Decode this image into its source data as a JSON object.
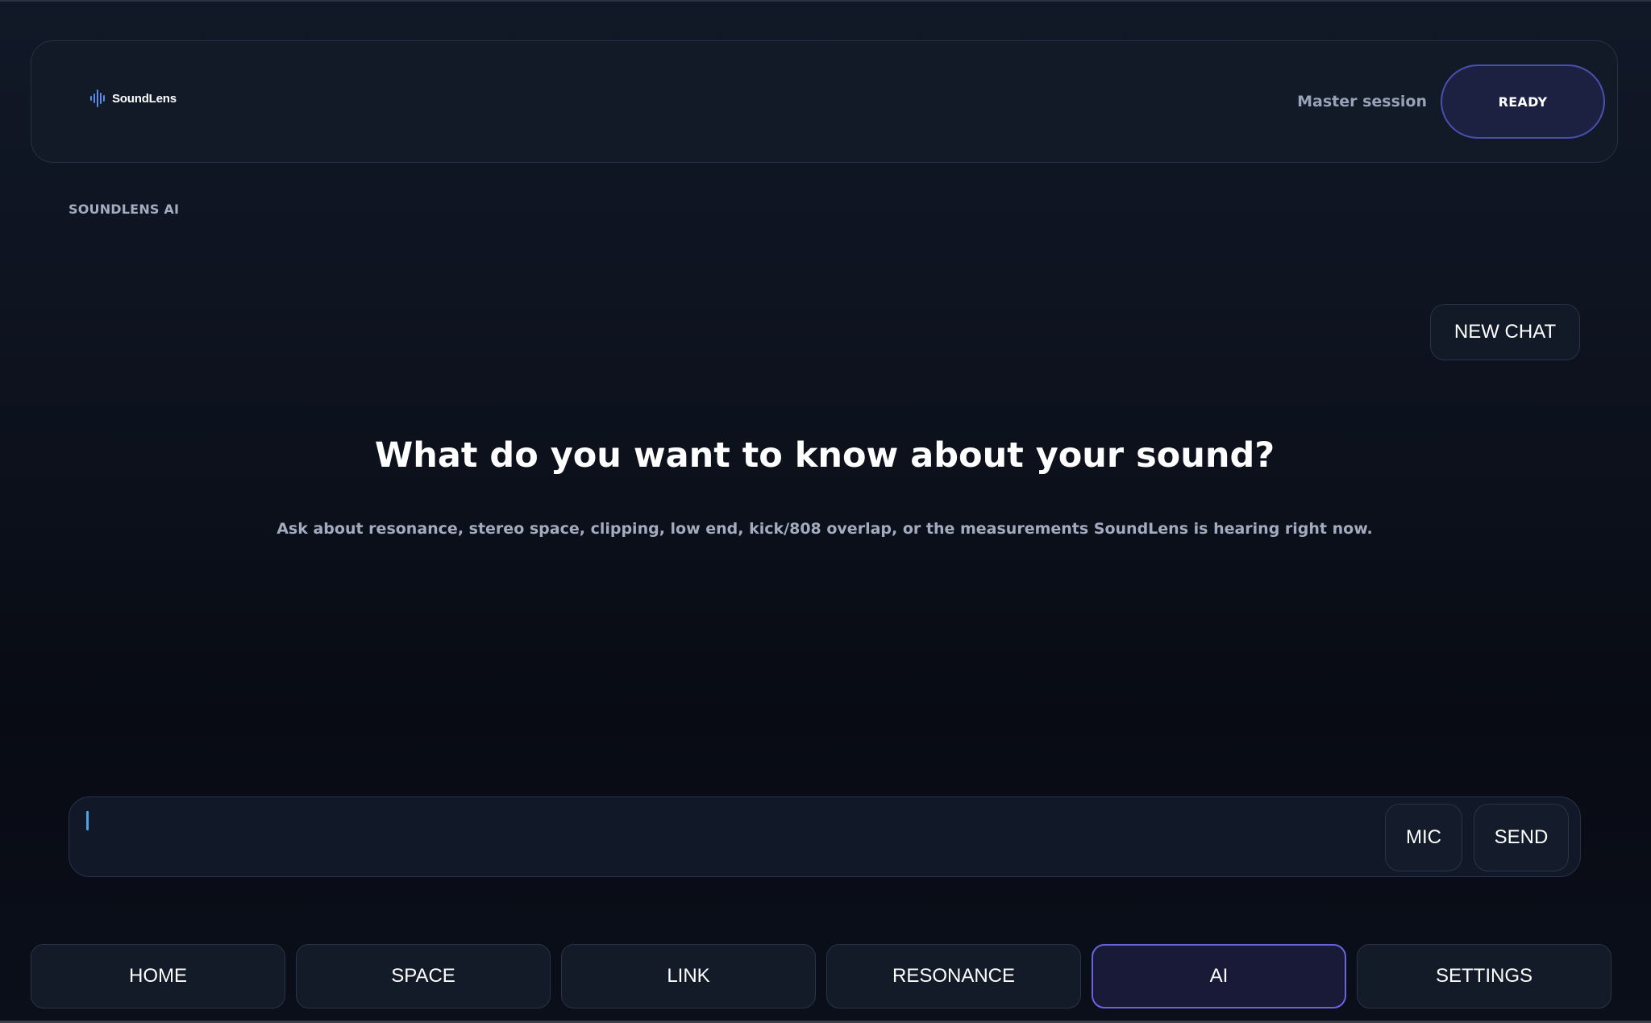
{
  "header": {
    "logo_text": "SoundLens",
    "session_label": "Master session",
    "status": "READY"
  },
  "section_label": "SOUNDLENS AI",
  "new_chat_label": "NEW CHAT",
  "hero": {
    "title": "What do you want to know about your sound?",
    "subtitle": "Ask about resonance, stereo space, clipping, low end, kick/808 overlap, or the measurements SoundLens is hearing right now."
  },
  "composer": {
    "value": "",
    "placeholder": "",
    "mic_label": "MIC",
    "send_label": "SEND"
  },
  "nav": {
    "tabs": [
      {
        "label": "HOME",
        "active": false
      },
      {
        "label": "SPACE",
        "active": false
      },
      {
        "label": "LINK",
        "active": false
      },
      {
        "label": "RESONANCE",
        "active": false
      },
      {
        "label": "AI",
        "active": true
      },
      {
        "label": "SETTINGS",
        "active": false
      }
    ]
  },
  "colors": {
    "accent": "#6a63e0",
    "status_pill_bg": "#1c2141",
    "caret": "#4aa3e8",
    "logo_gradient_start": "#2fb7d8",
    "logo_gradient_end": "#8a5cf0"
  },
  "icons": {
    "logo": "soundwave-bars-icon"
  }
}
